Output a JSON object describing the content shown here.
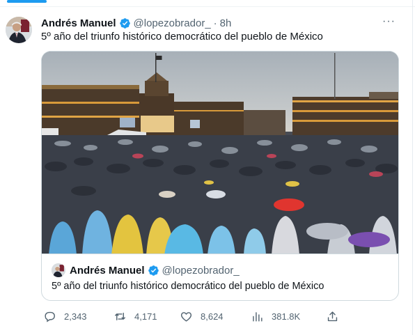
{
  "tweet": {
    "author_name": "Andrés Manuel",
    "handle": "@lopezobrador_",
    "separator": "·",
    "time": "8h",
    "text": "5º año del triunfo histórico democrático del pueblo de México",
    "more_label": "···"
  },
  "quote": {
    "author_name": "Andrés Manuel",
    "handle": "@lopezobrador_",
    "text": "5º año del triunfo histórico democrático del pueblo de México"
  },
  "actions": {
    "replies": "2,343",
    "retweets": "4,171",
    "likes": "8,624",
    "views": "381.8K"
  },
  "colors": {
    "accent": "#1d9bf0",
    "text": "#0f1419",
    "secondary": "#536471",
    "border": "#cfd9de"
  },
  "icons": [
    "verified-badge-icon",
    "more-icon",
    "reply-icon",
    "retweet-icon",
    "like-icon",
    "views-icon",
    "share-icon"
  ]
}
